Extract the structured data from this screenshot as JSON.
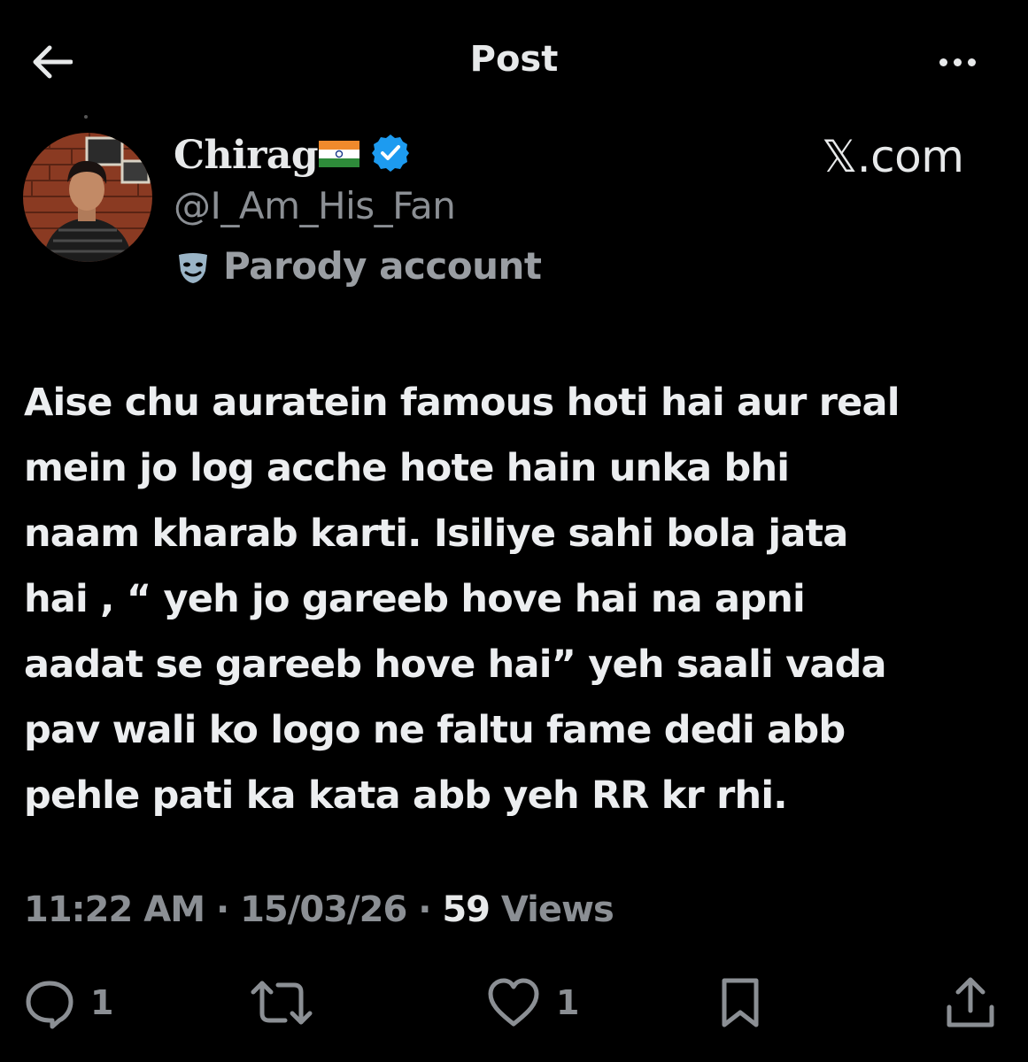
{
  "header": {
    "title": "Post",
    "back_icon": "arrow-left-icon",
    "more_icon": "more-horizontal-icon"
  },
  "author": {
    "name": "Chirag",
    "flag_icon": "india-flag-icon",
    "verified_icon": "verified-badge-icon",
    "verified_color": "#1d9bf0",
    "handle": "@I_Am_His_Fan",
    "label_icon": "theater-mask-icon",
    "label": "Parody account"
  },
  "watermark": "𝕏.com",
  "post": {
    "text": "Aise chu auratein famous hoti hai aur real\nmein jo log acche hote hain unka bhi\nnaam kharab karti. Isiliye sahi bola jata\nhai , “ yeh jo gareeb hove hai na apni\naadat se gareeb hove hai” yeh saali vada\npav wali ko logo ne faltu fame dedi abb\npehle pati ka kata abb yeh RR kr rhi."
  },
  "meta": {
    "time": "11:22 AM",
    "separator": " · ",
    "date": "15/03/26",
    "views_count": "59",
    "views_label": " Views"
  },
  "actions": {
    "reply": {
      "icon": "reply-icon",
      "count": "1"
    },
    "repost": {
      "icon": "repost-icon"
    },
    "like": {
      "icon": "heart-icon",
      "count": "1"
    },
    "bookmark": {
      "icon": "bookmark-icon"
    },
    "share": {
      "icon": "share-icon"
    }
  },
  "colors": {
    "background": "#000000",
    "text": "#e7e9ea",
    "secondary": "#8b8f94",
    "accent": "#1d9bf0"
  }
}
